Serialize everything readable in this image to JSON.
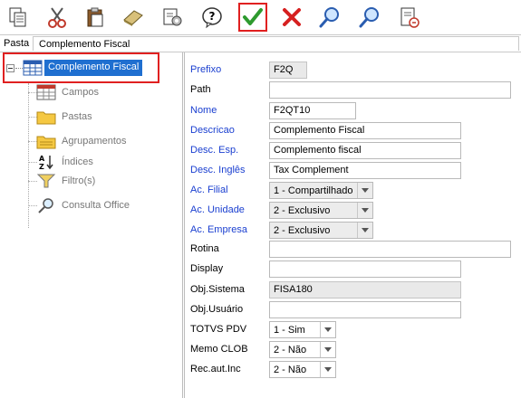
{
  "toolbar": {
    "buttons": [
      {
        "name": "copy-icon"
      },
      {
        "name": "cut-icon"
      },
      {
        "name": "paste-icon"
      },
      {
        "name": "erase-icon"
      },
      {
        "name": "properties-icon"
      },
      {
        "name": "help-icon"
      },
      {
        "name": "confirm-icon"
      },
      {
        "name": "cancel-icon"
      },
      {
        "name": "search-icon"
      },
      {
        "name": "search-next-icon"
      },
      {
        "name": "exit-icon"
      }
    ]
  },
  "pathbar": {
    "label": "Pasta",
    "value": "Complemento Fiscal"
  },
  "tree": {
    "root": "Complemento Fiscal",
    "items": [
      {
        "label": "Campos",
        "icon": "table-icon"
      },
      {
        "label": "Pastas",
        "icon": "folder-icon"
      },
      {
        "label": "Agrupamentos",
        "icon": "folder-group-icon"
      },
      {
        "label": "Índices",
        "icon": "sort-az-icon"
      },
      {
        "label": "Filtro(s)",
        "icon": "filter-icon"
      },
      {
        "label": "Consulta Office",
        "icon": "magnifier-icon"
      }
    ]
  },
  "form": {
    "prefixo": {
      "label": "Prefixo",
      "value": "F2Q"
    },
    "path": {
      "label": "Path",
      "value": ""
    },
    "nome": {
      "label": "Nome",
      "value": "F2QT10"
    },
    "descricao": {
      "label": "Descricao",
      "value": "Complemento Fiscal"
    },
    "desc_esp": {
      "label": "Desc. Esp.",
      "value": "Complemento fiscal"
    },
    "desc_ingles": {
      "label": "Desc. Inglês",
      "value": "Tax Complement"
    },
    "ac_filial": {
      "label": "Ac. Filial",
      "value": "1 - Compartilhado"
    },
    "ac_unidade": {
      "label": "Ac. Unidade",
      "value": "2 - Exclusivo"
    },
    "ac_empresa": {
      "label": "Ac. Empresa",
      "value": "2 - Exclusivo"
    },
    "rotina": {
      "label": "Rotina",
      "value": ""
    },
    "display": {
      "label": "Display",
      "value": ""
    },
    "obj_sistema": {
      "label": "Obj.Sistema",
      "value": "FISA180"
    },
    "obj_usuario": {
      "label": "Obj.Usuário",
      "value": ""
    },
    "totvs_pdv": {
      "label": "TOTVS PDV",
      "value": "1 - Sim"
    },
    "memo_clob": {
      "label": "Memo CLOB",
      "value": "2 - Não"
    },
    "rec_aut_inc": {
      "label": "Rec.aut.Inc",
      "value": "2 - Não"
    }
  },
  "colors": {
    "accent": "#1f6fd0",
    "highlight": "#e02020",
    "required_label": "#1a3fd0"
  }
}
